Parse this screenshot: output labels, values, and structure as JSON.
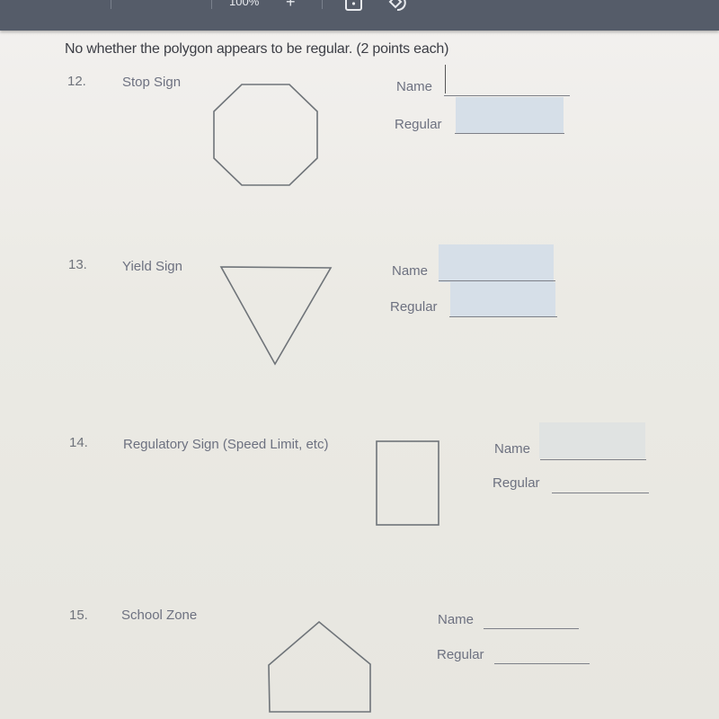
{
  "toolbar": {
    "zoom_level": "100%",
    "zoom_in_label": "+",
    "icons": [
      "download-icon",
      "rotate-icon"
    ]
  },
  "worksheet": {
    "instruction": "No whether the polygon appears to be regular.  (2 points each)",
    "field_labels": {
      "name": "Name",
      "regular": "Regular"
    },
    "questions": [
      {
        "number": "12.",
        "label": "Stop Sign",
        "shape": "octagon",
        "name_value": "",
        "regular_value": ""
      },
      {
        "number": "13.",
        "label": "Yield Sign",
        "shape": "triangle",
        "name_value": "",
        "regular_value": ""
      },
      {
        "number": "14.",
        "label": "Regulatory Sign (Speed Limit, etc)",
        "shape": "rectangle",
        "name_value": "",
        "regular_value": ""
      },
      {
        "number": "15.",
        "label": "School Zone",
        "shape": "pentagon",
        "name_value": "",
        "regular_value": ""
      }
    ]
  },
  "colors": {
    "toolbar_bg": "#555c69",
    "page_bg": "#ecebe6",
    "field_highlight": "#d6dfe8"
  }
}
